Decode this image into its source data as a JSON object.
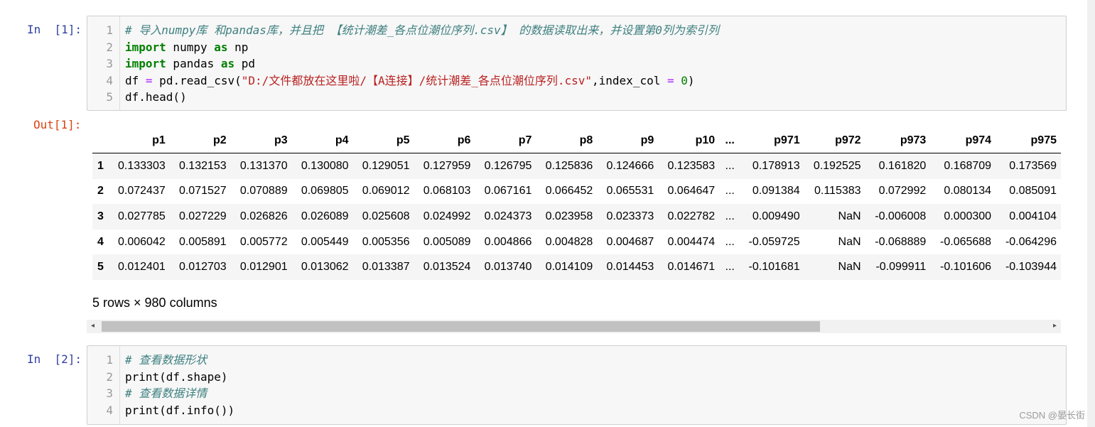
{
  "cell1": {
    "in_prompt": "In  [1]:",
    "lines": [
      {
        "n": "1",
        "tokens": [
          {
            "c": "cm",
            "t": "# 导入numpy库 和pandas库，并且把 【统计潮差_各点位潮位序列.csv】 的数据读取出来，并设置第0列为索引列"
          }
        ]
      },
      {
        "n": "2",
        "tokens": [
          {
            "c": "kw",
            "t": "import"
          },
          {
            "c": "",
            "t": " numpy "
          },
          {
            "c": "kw",
            "t": "as"
          },
          {
            "c": "",
            "t": " np"
          }
        ]
      },
      {
        "n": "3",
        "tokens": [
          {
            "c": "kw",
            "t": "import"
          },
          {
            "c": "",
            "t": " pandas "
          },
          {
            "c": "kw",
            "t": "as"
          },
          {
            "c": "",
            "t": " pd"
          }
        ]
      },
      {
        "n": "4",
        "tokens": [
          {
            "c": "",
            "t": "df "
          },
          {
            "c": "op",
            "t": "="
          },
          {
            "c": "",
            "t": " pd.read_csv("
          },
          {
            "c": "st",
            "t": "\"D:/文件都放在这里啦/【A连接】/统计潮差_各点位潮位序列.csv\""
          },
          {
            "c": "",
            "t": ",index_col "
          },
          {
            "c": "op",
            "t": "="
          },
          {
            "c": "",
            "t": " "
          },
          {
            "c": "nu",
            "t": "0"
          },
          {
            "c": "",
            "t": ")"
          }
        ]
      },
      {
        "n": "5",
        "tokens": [
          {
            "c": "",
            "t": "df.head()"
          }
        ]
      }
    ]
  },
  "output1": {
    "out_prompt": "Out[1]:",
    "columns": [
      "",
      "p1",
      "p2",
      "p3",
      "p4",
      "p5",
      "p6",
      "p7",
      "p8",
      "p9",
      "p10",
      "...",
      "p971",
      "p972",
      "p973",
      "p974",
      "p975"
    ],
    "rows": [
      [
        "1",
        "0.133303",
        "0.132153",
        "0.131370",
        "0.130080",
        "0.129051",
        "0.127959",
        "0.126795",
        "0.125836",
        "0.124666",
        "0.123583",
        "...",
        "0.178913",
        "0.192525",
        "0.161820",
        "0.168709",
        "0.173569"
      ],
      [
        "2",
        "0.072437",
        "0.071527",
        "0.070889",
        "0.069805",
        "0.069012",
        "0.068103",
        "0.067161",
        "0.066452",
        "0.065531",
        "0.064647",
        "...",
        "0.091384",
        "0.115383",
        "0.072992",
        "0.080134",
        "0.085091"
      ],
      [
        "3",
        "0.027785",
        "0.027229",
        "0.026826",
        "0.026089",
        "0.025608",
        "0.024992",
        "0.024373",
        "0.023958",
        "0.023373",
        "0.022782",
        "...",
        "0.009490",
        "NaN",
        "-0.006008",
        "0.000300",
        "0.004104"
      ],
      [
        "4",
        "0.006042",
        "0.005891",
        "0.005772",
        "0.005449",
        "0.005356",
        "0.005089",
        "0.004866",
        "0.004828",
        "0.004687",
        "0.004474",
        "...",
        "-0.059725",
        "NaN",
        "-0.068889",
        "-0.065688",
        "-0.064296"
      ],
      [
        "5",
        "0.012401",
        "0.012703",
        "0.012901",
        "0.013062",
        "0.013387",
        "0.013524",
        "0.013740",
        "0.014109",
        "0.014453",
        "0.014671",
        "...",
        "-0.101681",
        "NaN",
        "-0.099911",
        "-0.101606",
        "-0.103944"
      ]
    ],
    "shape_note": "5 rows × 980 columns",
    "scroll_left": "◂",
    "scroll_right": "▸"
  },
  "cell2": {
    "in_prompt": "In  [2]:",
    "lines": [
      {
        "n": "1",
        "tokens": [
          {
            "c": "cm",
            "t": "# 查看数据形状"
          }
        ]
      },
      {
        "n": "2",
        "tokens": [
          {
            "c": "",
            "t": "print(df.shape)"
          }
        ]
      },
      {
        "n": "3",
        "tokens": [
          {
            "c": "cm",
            "t": "# 查看数据详情"
          }
        ]
      },
      {
        "n": "4",
        "tokens": [
          {
            "c": "",
            "t": "print(df.info())"
          }
        ]
      }
    ]
  },
  "watermark": "CSDN @晏长街"
}
